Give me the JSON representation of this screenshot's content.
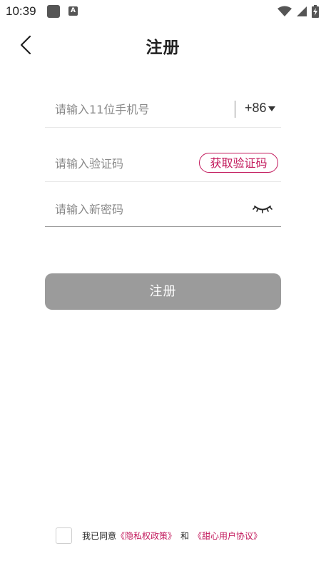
{
  "status_bar": {
    "time": "10:39",
    "icons": [
      "notification-square-icon",
      "a-badge-icon",
      "wifi-icon",
      "signal-icon",
      "battery-charging-icon"
    ],
    "a_badge": "A"
  },
  "header": {
    "back_icon": "chevron-left-icon",
    "title": "注册"
  },
  "form": {
    "phone": {
      "placeholder": "请输入11位手机号",
      "value": "",
      "country_code": "+86"
    },
    "code": {
      "placeholder": "请输入验证码",
      "value": "",
      "get_code_label": "获取验证码"
    },
    "password": {
      "placeholder": "请输入新密码",
      "value": "",
      "visibility_icon": "eye-closed-icon"
    },
    "submit_label": "注册"
  },
  "agreement": {
    "checked": false,
    "prefix": "我已同意",
    "privacy_link": "《隐私权政策》",
    "and": "和",
    "user_agreement_link": "《甜心用户协议》"
  },
  "colors": {
    "accent": "#c2185b",
    "button_disabled": "#9b9b9b",
    "background": "#ffffff"
  }
}
